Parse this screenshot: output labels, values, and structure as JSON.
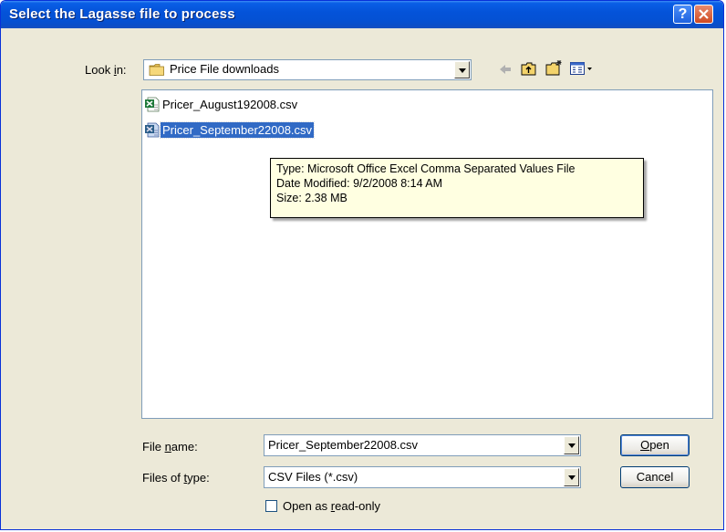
{
  "window": {
    "title": "Select the Lagasse file to process"
  },
  "titlebar": {
    "help_label": "?",
    "close_label": "×"
  },
  "look_in": {
    "label_prefix": "Look ",
    "label_underline": "i",
    "label_suffix": "n:",
    "value": "Price File downloads"
  },
  "files": [
    {
      "name": "Pricer_August192008.csv",
      "selected": false
    },
    {
      "name": "Pricer_September22008.csv",
      "selected": true
    }
  ],
  "tooltip": {
    "type": "Type: Microsoft Office Excel Comma Separated Values File",
    "modified": "Date Modified: 9/2/2008 8:14 AM",
    "size": "Size: 2.38 MB"
  },
  "file_name": {
    "label_prefix": "File ",
    "label_underline": "n",
    "label_suffix": "ame:",
    "value": "Pricer_September22008.csv"
  },
  "file_type": {
    "label_prefix": "Files of ",
    "label_underline": "t",
    "label_suffix": "ype:",
    "value": "CSV Files (*.csv)"
  },
  "buttons": {
    "open_underline": "O",
    "open_rest": "pen",
    "cancel": "Cancel"
  },
  "read_only": {
    "label_prefix": "Open as ",
    "label_underline": "r",
    "label_suffix": "ead-only"
  },
  "colors": {
    "titlebar": "#0453d9",
    "selection": "#316ac5",
    "tooltip_bg": "#ffffe1",
    "dialog_bg": "#ece9d8"
  }
}
